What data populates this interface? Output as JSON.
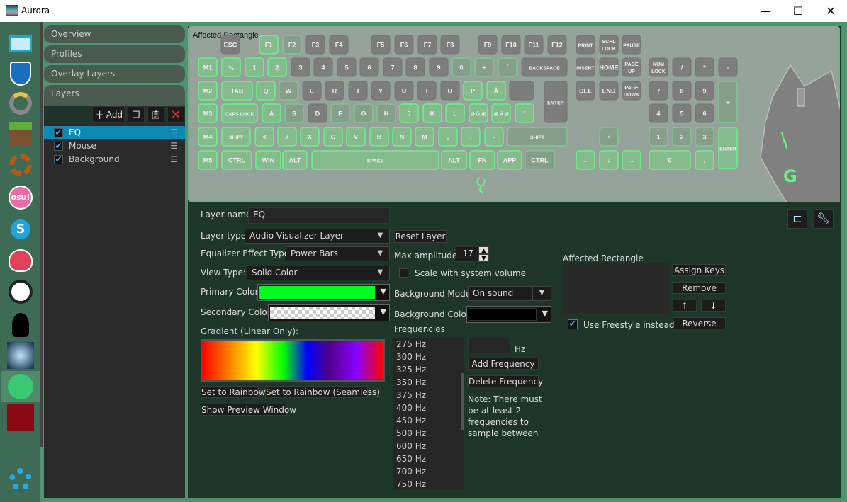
{
  "window": {
    "title": "Aurora",
    "minimize": "—",
    "maximize": "☐",
    "close": "✕"
  },
  "apps": [
    "desktop",
    "rocket-league",
    "overwatch",
    "minecraft",
    "generic-application",
    "osu",
    "skype",
    "slime-rancher",
    "dishonored",
    "limbo",
    "ori",
    "spotify",
    "hexagon",
    "settings"
  ],
  "sidebar": {
    "tabs": [
      "Overview",
      "Profiles",
      "Overlay Layers",
      "Layers"
    ],
    "add_label": "Add",
    "layers": [
      {
        "name": "EQ",
        "checked": true,
        "selected": true
      },
      {
        "name": "Mouse",
        "checked": true
      },
      {
        "name": "Background",
        "checked": true
      }
    ]
  },
  "keyboard": {
    "caption": "Affected Rectangle",
    "keys": [
      [
        "ESC",
        0
      ],
      [
        "F1",
        2
      ],
      [
        "F2",
        1
      ],
      [
        "F3",
        0
      ],
      [
        "F4",
        0
      ],
      [
        "F5",
        0
      ],
      [
        "F6",
        0
      ],
      [
        "F7",
        0
      ],
      [
        "F8",
        0
      ],
      [
        "F9",
        0
      ],
      [
        "F10",
        0
      ],
      [
        "F11",
        0
      ],
      [
        "F12",
        0
      ],
      [
        "PRINT",
        0
      ],
      [
        "SCRL LOCK",
        0
      ],
      [
        "PAUSE",
        0
      ],
      [
        "M1",
        2
      ],
      [
        "½",
        2
      ],
      [
        "1",
        2
      ],
      [
        "2",
        2
      ],
      [
        "3",
        0
      ],
      [
        "4",
        0
      ],
      [
        "5",
        0
      ],
      [
        "6",
        0
      ],
      [
        "7",
        0
      ],
      [
        "8",
        0
      ],
      [
        "9",
        0
      ],
      [
        "0",
        1
      ],
      [
        "+",
        1
      ],
      [
        "´",
        1
      ],
      [
        "BACKSPACE",
        0
      ],
      [
        "INSERT",
        0
      ],
      [
        "HOME",
        0
      ],
      [
        "PAGE UP",
        0
      ],
      [
        "NUM LOCK",
        0
      ],
      [
        "/",
        0
      ],
      [
        "*",
        0
      ],
      [
        "-",
        0
      ],
      [
        "M2",
        2
      ],
      [
        "TAB",
        2
      ],
      [
        "Q",
        2
      ],
      [
        "W",
        1
      ],
      [
        "E",
        0
      ],
      [
        "R",
        0
      ],
      [
        "T",
        0
      ],
      [
        "Y",
        0
      ],
      [
        "U",
        0
      ],
      [
        "I",
        0
      ],
      [
        "O",
        0
      ],
      [
        "P",
        2
      ],
      [
        "Å",
        2
      ],
      [
        "¨",
        0
      ],
      [
        "ENTER",
        0
      ],
      [
        "DEL",
        0
      ],
      [
        "END",
        0
      ],
      [
        "PAGE DOWN",
        0
      ],
      [
        "7",
        0
      ],
      [
        "8",
        0
      ],
      [
        "9",
        0
      ],
      [
        "+",
        1
      ],
      [
        "M3",
        2
      ],
      [
        "CAPS LOCK",
        2
      ],
      [
        "A",
        2
      ],
      [
        "S",
        1
      ],
      [
        "D",
        0
      ],
      [
        "F",
        1
      ],
      [
        "G",
        1
      ],
      [
        "H",
        1
      ],
      [
        "J",
        2
      ],
      [
        "K",
        2
      ],
      [
        "L",
        2
      ],
      [
        "Ø Ö Æ",
        2
      ],
      [
        "Æ Ä Ø",
        2
      ],
      [
        "'",
        2
      ],
      [
        "4",
        0
      ],
      [
        "5",
        0
      ],
      [
        "6",
        0
      ],
      [
        "M4",
        2
      ],
      [
        "SHIFT",
        2
      ],
      [
        "<",
        2
      ],
      [
        "Z",
        2
      ],
      [
        "X",
        2
      ],
      [
        "C",
        2
      ],
      [
        "V",
        2
      ],
      [
        "B",
        2
      ],
      [
        "N",
        2
      ],
      [
        "M",
        2
      ],
      [
        ",",
        2
      ],
      [
        ".",
        2
      ],
      [
        "-",
        2
      ],
      [
        "SHIFT",
        1
      ],
      [
        "↑",
        1
      ],
      [
        "1",
        1
      ],
      [
        "2",
        1
      ],
      [
        "3",
        1
      ],
      [
        "ENTER",
        2
      ],
      [
        "M5",
        2
      ],
      [
        "CTRL",
        2
      ],
      [
        "WIN",
        2
      ],
      [
        "ALT",
        2
      ],
      [
        "SPACE",
        2
      ],
      [
        "ALT",
        2
      ],
      [
        "FN",
        2
      ],
      [
        "APP",
        2
      ],
      [
        "CTRL",
        1
      ],
      [
        "←",
        2
      ],
      [
        "↓",
        2
      ],
      [
        "→",
        2
      ],
      [
        "0",
        2
      ],
      [
        ".",
        2
      ]
    ],
    "colors": {
      "bright": "#6cf08a",
      "dim": "#7fc591",
      "grey": "#7d7d7d"
    }
  },
  "props": {
    "layer_name_label": "Layer name:",
    "layer_name": "EQ",
    "layer_type_label": "Layer type:",
    "layer_type": "Audio Visualizer Layer",
    "reset_layer": "Reset Layer",
    "eq_type_label": "Equalizer Effect Type:",
    "eq_type": "Power Bars",
    "max_amp_label": "Max amplitude:",
    "max_amp": "17",
    "view_type_label": "View Type:",
    "view_type": "Solid Color",
    "scale_label": "Scale with system volume",
    "scale_checked": false,
    "primary_label": "Primary Color:",
    "primary_color": "#00ff1e",
    "secondary_label": "Secondary Color:",
    "secondary_color": "transparent",
    "bg_mode_label": "Background Mode:",
    "bg_mode": "On sound",
    "bg_color_label": "Background Color:",
    "bg_color": "#000000",
    "gradient_label": "Gradient (Linear Only):",
    "set_rainbow": "Set to Rainbow",
    "set_rainbow_seamless": "Set to Rainbow (Seamless)",
    "show_preview": "Show Preview Window",
    "frequencies_label": "Frequencies",
    "frequencies": [
      "275 Hz",
      "300 Hz",
      "325 Hz",
      "350 Hz",
      "375 Hz",
      "400 Hz",
      "450 Hz",
      "500 Hz",
      "600 Hz",
      "650 Hz",
      "700 Hz",
      "750 Hz"
    ],
    "hz_unit": "Hz",
    "freq_input": "",
    "add_freq": "Add Frequency",
    "delete_freq": "Delete Frequency",
    "note": "Note: There must be at least 2 frequencies to sample between",
    "affected_label": "Affected Rectangle",
    "assign_keys": "Assign Keys",
    "remove": "Remove",
    "up": "↑",
    "down": "↓",
    "reverse": "Reverse",
    "freestyle_label": "Use Freestyle instead",
    "freestyle_checked": true
  }
}
